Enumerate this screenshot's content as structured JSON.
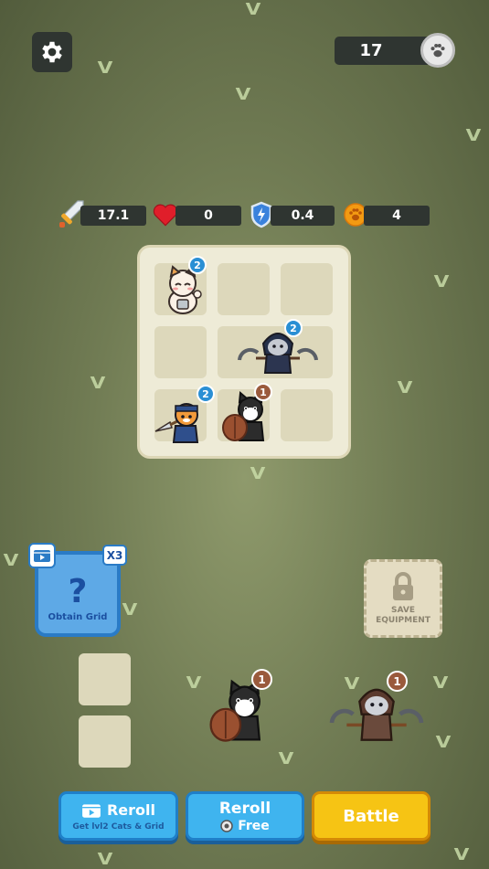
{
  "header": {
    "coins": "17",
    "settings_icon": "gear-icon",
    "coin_icon": "paw-coin-icon"
  },
  "stats": [
    {
      "icon": "sword-icon",
      "value": "17.1"
    },
    {
      "icon": "heart-icon",
      "value": "0"
    },
    {
      "icon": "shield-icon",
      "value": "0.4"
    },
    {
      "icon": "paw-icon",
      "value": "4"
    }
  ],
  "board": {
    "units": [
      {
        "name": "maneki-cat",
        "level": "2",
        "color": "blue"
      },
      {
        "name": "hooded-scythe-cat",
        "level": "2",
        "color": "blue"
      },
      {
        "name": "spear-cat",
        "level": "2",
        "color": "blue"
      },
      {
        "name": "shield-cat",
        "level": "1",
        "color": "brown"
      }
    ]
  },
  "obtain_grid": {
    "label": "Obtain Grid",
    "symbol": "?",
    "multiplier": "X3"
  },
  "save_equipment": {
    "line1": "SAVE",
    "line2": "EQUIPMENT"
  },
  "shop": {
    "units": [
      {
        "name": "shield-cat",
        "level": "1"
      },
      {
        "name": "hooded-scythe-cat",
        "level": "1"
      }
    ]
  },
  "buttons": {
    "reroll_ad_title": "Reroll",
    "reroll_ad_sub": "Get lvl2 Cats & Grid",
    "reroll_free_title": "Reroll",
    "reroll_free_sub": "Free",
    "battle": "Battle"
  },
  "colors": {
    "accent_blue": "#3fb4ef",
    "accent_yellow": "#f6c414",
    "level_blue": "#2a8fd4",
    "level_brown": "#9a5a3c"
  }
}
